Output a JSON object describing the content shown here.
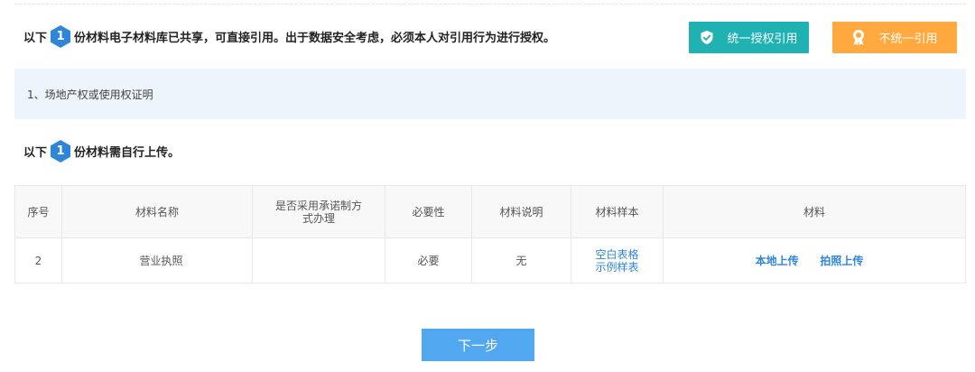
{
  "shared_section": {
    "prefix": "以下",
    "count": "1",
    "suffix": "份材料电子材料库已共享，可直接引用。出于数据安全考虑，必须本人对引用行为进行授权。",
    "items": [
      "1、场地产权或使用权证明"
    ]
  },
  "buttons": {
    "authorize_all": "统一授权引用",
    "no_reference": "不统一引用",
    "next_step": "下一步"
  },
  "upload_section": {
    "prefix": "以下",
    "count": "1",
    "suffix": "份材料需自行上传。"
  },
  "table": {
    "headers": [
      "序号",
      "材料名称",
      "是否采用承诺制方式办理",
      "必要性",
      "材料说明",
      "材料样本",
      "材料"
    ],
    "rows": [
      {
        "index": "2",
        "name": "营业执照",
        "commitment": "",
        "necessity": "必要",
        "description": "无",
        "samples": [
          "空白表格",
          "示例样表"
        ],
        "upload_links": [
          "本地上传",
          "拍照上传"
        ]
      }
    ]
  },
  "colors": {
    "primary_blue": "#2f86d8",
    "authorize_teal": "#20b1b3",
    "no_reference_orange": "#ffa93f",
    "next_button_blue": "#51a8f0",
    "shared_box_bg": "#edf4fb"
  },
  "icons": {
    "authorize_all": "shield-check-icon",
    "no_reference": "award-medal-icon"
  }
}
